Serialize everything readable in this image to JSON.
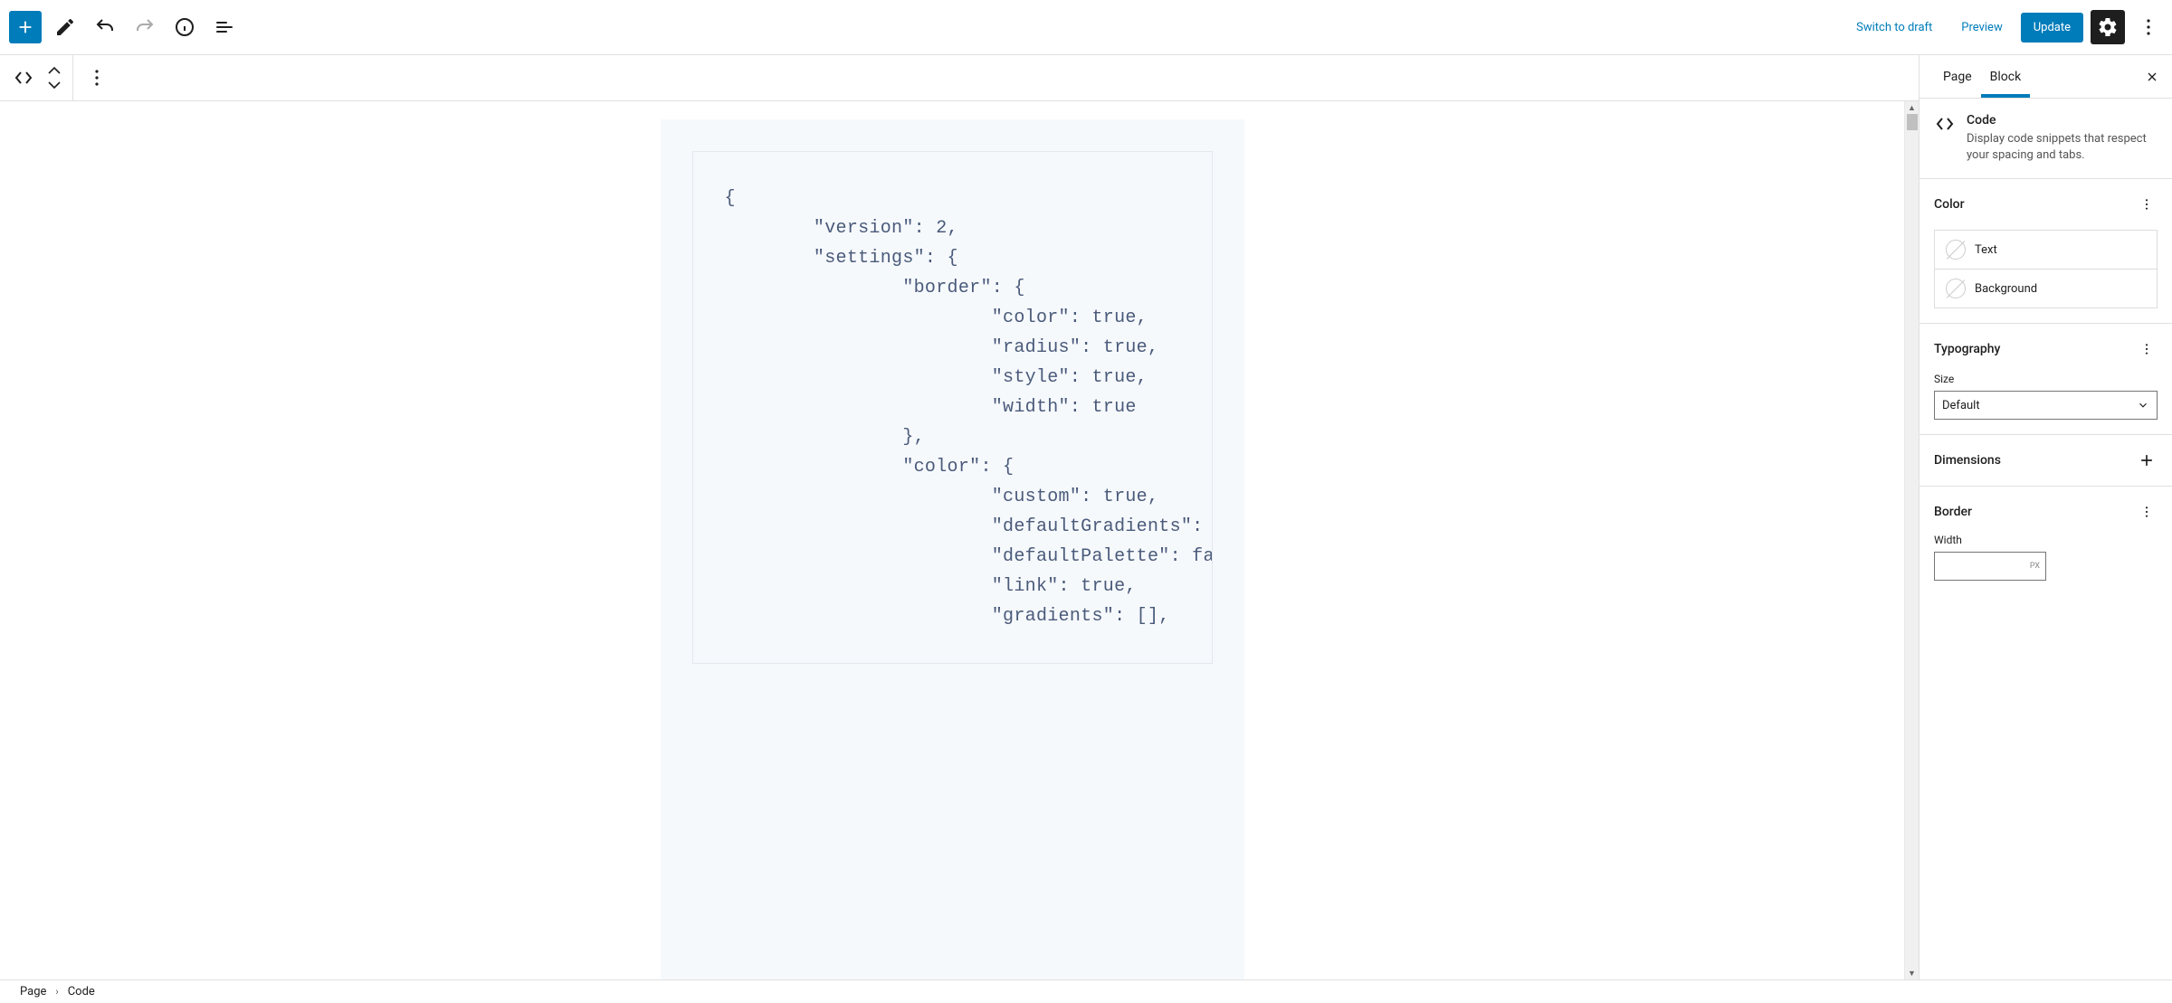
{
  "topbar": {
    "switch_draft": "Switch to draft",
    "preview": "Preview",
    "update": "Update"
  },
  "code_content": "{\n        \"version\": 2,\n        \"settings\": {\n                \"border\": {\n                        \"color\": true,\n                        \"radius\": true,\n                        \"style\": true,\n                        \"width\": true\n                },\n                \"color\": {\n                        \"custom\": true,\n                        \"defaultGradients\": true,\n                        \"defaultPalette\": false,\n                        \"link\": true,\n                        \"gradients\": [],",
  "sidebar": {
    "tabs": {
      "page": "Page",
      "block": "Block"
    },
    "block_info": {
      "title": "Code",
      "desc": "Display code snippets that respect your spacing and tabs."
    },
    "panels": {
      "color": {
        "title": "Color",
        "text": "Text",
        "background": "Background"
      },
      "typography": {
        "title": "Typography",
        "size_label": "Size",
        "size_value": "Default"
      },
      "dimensions": {
        "title": "Dimensions"
      },
      "border": {
        "title": "Border",
        "width_label": "Width",
        "width_unit": "PX"
      }
    }
  },
  "breadcrumb": {
    "root": "Page",
    "current": "Code"
  }
}
